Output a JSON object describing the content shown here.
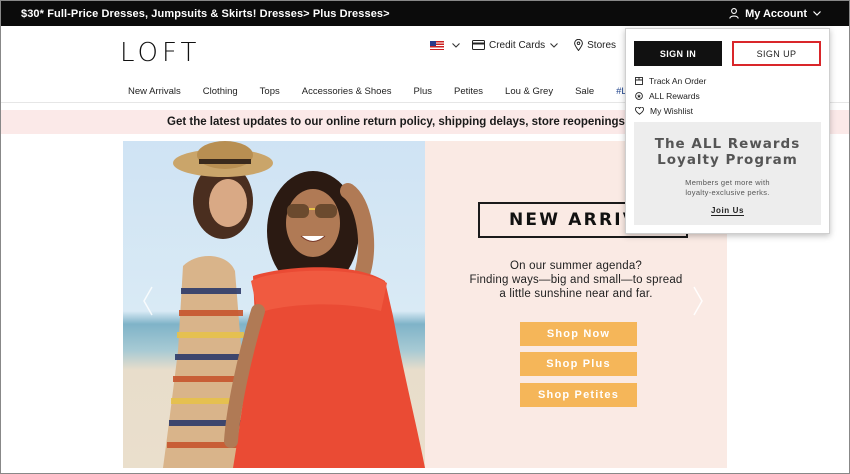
{
  "promo_bar": {
    "text": "$30* Full-Price Dresses, Jumpsuits & Skirts! Dresses> Plus Dresses>",
    "account_label": "My Account",
    "account_icon": "user-icon"
  },
  "header": {
    "logo": "LOFT",
    "country_icon": "us-flag-icon",
    "credit_cards_label": "Credit Cards",
    "stores_label": "Stores"
  },
  "nav": {
    "items": [
      "New Arrivals",
      "Clothing",
      "Tops",
      "Accessories & Shoes",
      "Plus",
      "Petites",
      "Lou & Grey",
      "Sale",
      "#LOFTimist"
    ]
  },
  "announcement": {
    "text": "Get the latest updates to our online return policy, shipping delays, store reopenings and"
  },
  "hero": {
    "headline": "NEW ARRIVALS",
    "copy_line1": "On our summer agenda?",
    "copy_line2": "Finding ways—big and small—to spread",
    "copy_line3": "a little sunshine near and far.",
    "buttons": [
      "Shop Now",
      "Shop Plus",
      "Shop Petites"
    ],
    "button_color": "#f5b659",
    "panel_color": "#faeae4"
  },
  "account_dropdown": {
    "sign_in": "SIGN IN",
    "sign_up": "SIGN UP",
    "links": [
      {
        "label": "Track An Order",
        "icon": "package-icon"
      },
      {
        "label": "ALL Rewards",
        "icon": "rewards-icon"
      },
      {
        "label": "My Wishlist",
        "icon": "heart-icon"
      }
    ],
    "rewards_title_line1": "The ALL Rewards",
    "rewards_title_line2": "Loyalty Program",
    "rewards_desc_line1": "Members get more with",
    "rewards_desc_line2": "loyalty-exclusive perks.",
    "join_label": "Join Us",
    "signup_border_color": "#d9262a"
  }
}
